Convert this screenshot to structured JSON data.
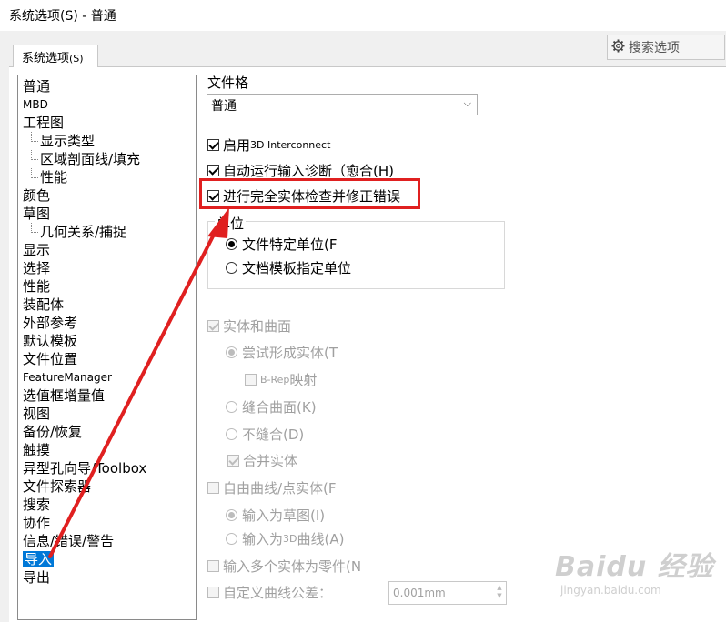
{
  "window": {
    "title": "系统选项(S) - 普通"
  },
  "search": {
    "label": "搜索选项"
  },
  "tab": {
    "label": "系统选项",
    "suffix": "(S)"
  },
  "tree": {
    "items": [
      {
        "label": "普通",
        "level": 0,
        "small": false
      },
      {
        "label": "MBD",
        "level": 0,
        "small": true
      },
      {
        "label": "工程图",
        "level": 0,
        "small": false
      },
      {
        "label": "显示类型",
        "level": 1,
        "small": false
      },
      {
        "label": "区域剖面线/填充",
        "level": 1,
        "small": false
      },
      {
        "label": "性能",
        "level": 1,
        "small": false
      },
      {
        "label": "颜色",
        "level": 0,
        "small": false
      },
      {
        "label": "草图",
        "level": 0,
        "small": false
      },
      {
        "label": "几何关系/捕捉",
        "level": 1,
        "small": false
      },
      {
        "label": "显示",
        "level": 0,
        "small": false
      },
      {
        "label": "选择",
        "level": 0,
        "small": false
      },
      {
        "label": "性能",
        "level": 0,
        "small": false
      },
      {
        "label": "装配体",
        "level": 0,
        "small": false
      },
      {
        "label": "外部参考",
        "level": 0,
        "small": false
      },
      {
        "label": "默认模板",
        "level": 0,
        "small": false
      },
      {
        "label": "文件位置",
        "level": 0,
        "small": false
      },
      {
        "label": "FeatureManager",
        "level": 0,
        "small": true
      },
      {
        "label": "选值框增量值",
        "level": 0,
        "small": false
      },
      {
        "label": "视图",
        "level": 0,
        "small": false
      },
      {
        "label": "备份/恢复",
        "level": 0,
        "small": false
      },
      {
        "label": "触摸",
        "level": 0,
        "small": false
      },
      {
        "label": "异型孔向导/Toolbox",
        "level": 0,
        "small": false
      },
      {
        "label": "文件探索器",
        "level": 0,
        "small": false
      },
      {
        "label": "搜索",
        "level": 0,
        "small": false
      },
      {
        "label": "协作",
        "level": 0,
        "small": false
      },
      {
        "label": "信息/错误/警告",
        "level": 0,
        "small": false
      },
      {
        "label": "导入",
        "level": 0,
        "small": false,
        "selected": true
      },
      {
        "label": "导出",
        "level": 0,
        "small": false
      }
    ]
  },
  "main": {
    "format_label": "文件格",
    "format_value": "普通",
    "enable_3d_a": "启用 ",
    "enable_3d_b": "3D Interconnect",
    "auto_diag": "自动运行输入诊断（愈合(H)",
    "full_check": "进行完全实体检查并修正错误",
    "units_title": "单位",
    "unit_file": "文件特定单位(F",
    "unit_template": "文档模板指定单位",
    "solid_surface": "实体和曲面",
    "try_solid": "尝试形成实体(T",
    "brep_a": "B-Rep",
    "brep_b": " 映射",
    "knit_surface": "缝合曲面(K)",
    "no_knit": "不缝合(D)",
    "merge_solids": "合并实体",
    "free_curves": "自由曲线/点实体(F",
    "as_sketch": "输入为草图(I)",
    "as_3d_a": "输入为 ",
    "as_3d_b": "3D",
    "as_3d_c": " 曲线(A)",
    "multi_solid": "输入多个实体为零件(N",
    "custom_tol": "自定义曲线公差：",
    "tol_value": "0.001mm"
  },
  "watermark": {
    "main": "Baidu 经验",
    "sub": "jingyan.baidu.com"
  },
  "colors": {
    "selection": "#0078d7",
    "highlight": "#e02020",
    "arrow": "#e02020"
  }
}
